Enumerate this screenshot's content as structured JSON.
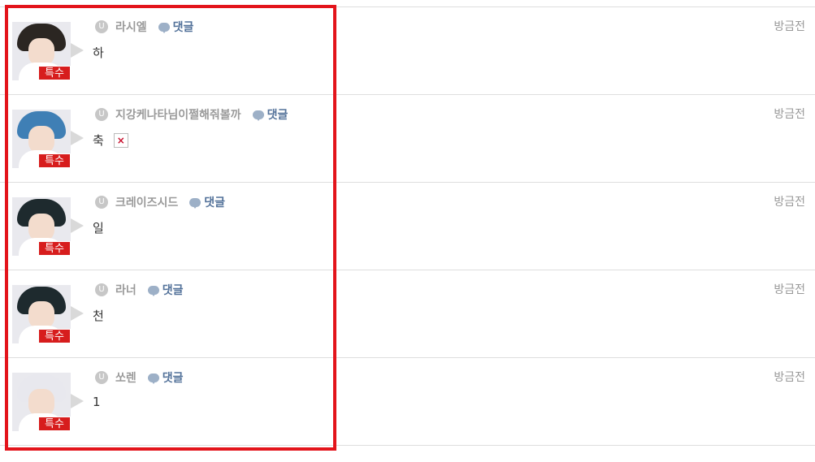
{
  "comments": [
    {
      "nick": "라시엘",
      "reply_label": "댓글",
      "text": "하",
      "time": "방금전",
      "badge": "특수",
      "level": "U",
      "hair": "#2b2622"
    },
    {
      "nick": "지강케나타님이쩔해줘볼까",
      "reply_label": "댓글",
      "text": "축",
      "time": "방금전",
      "badge": "특수",
      "level": "U",
      "hair": "#3f7fb5",
      "broken_image": "×"
    },
    {
      "nick": "크레이즈시드",
      "reply_label": "댓글",
      "text": "일",
      "time": "방금전",
      "badge": "특수",
      "level": "U",
      "hair": "#1e2a2e"
    },
    {
      "nick": "라너",
      "reply_label": "댓글",
      "text": "천",
      "time": "방금전",
      "badge": "특수",
      "level": "U",
      "hair": "#1e2a2e"
    },
    {
      "nick": "쏘렌",
      "reply_label": "댓글",
      "text": "1",
      "time": "방금전",
      "badge": "특수",
      "level": "U",
      "hair": "#e8e8ee"
    }
  ],
  "colors": {
    "highlight": "#e3141b",
    "badge": "#d71d1d",
    "reply": "#53729a"
  }
}
